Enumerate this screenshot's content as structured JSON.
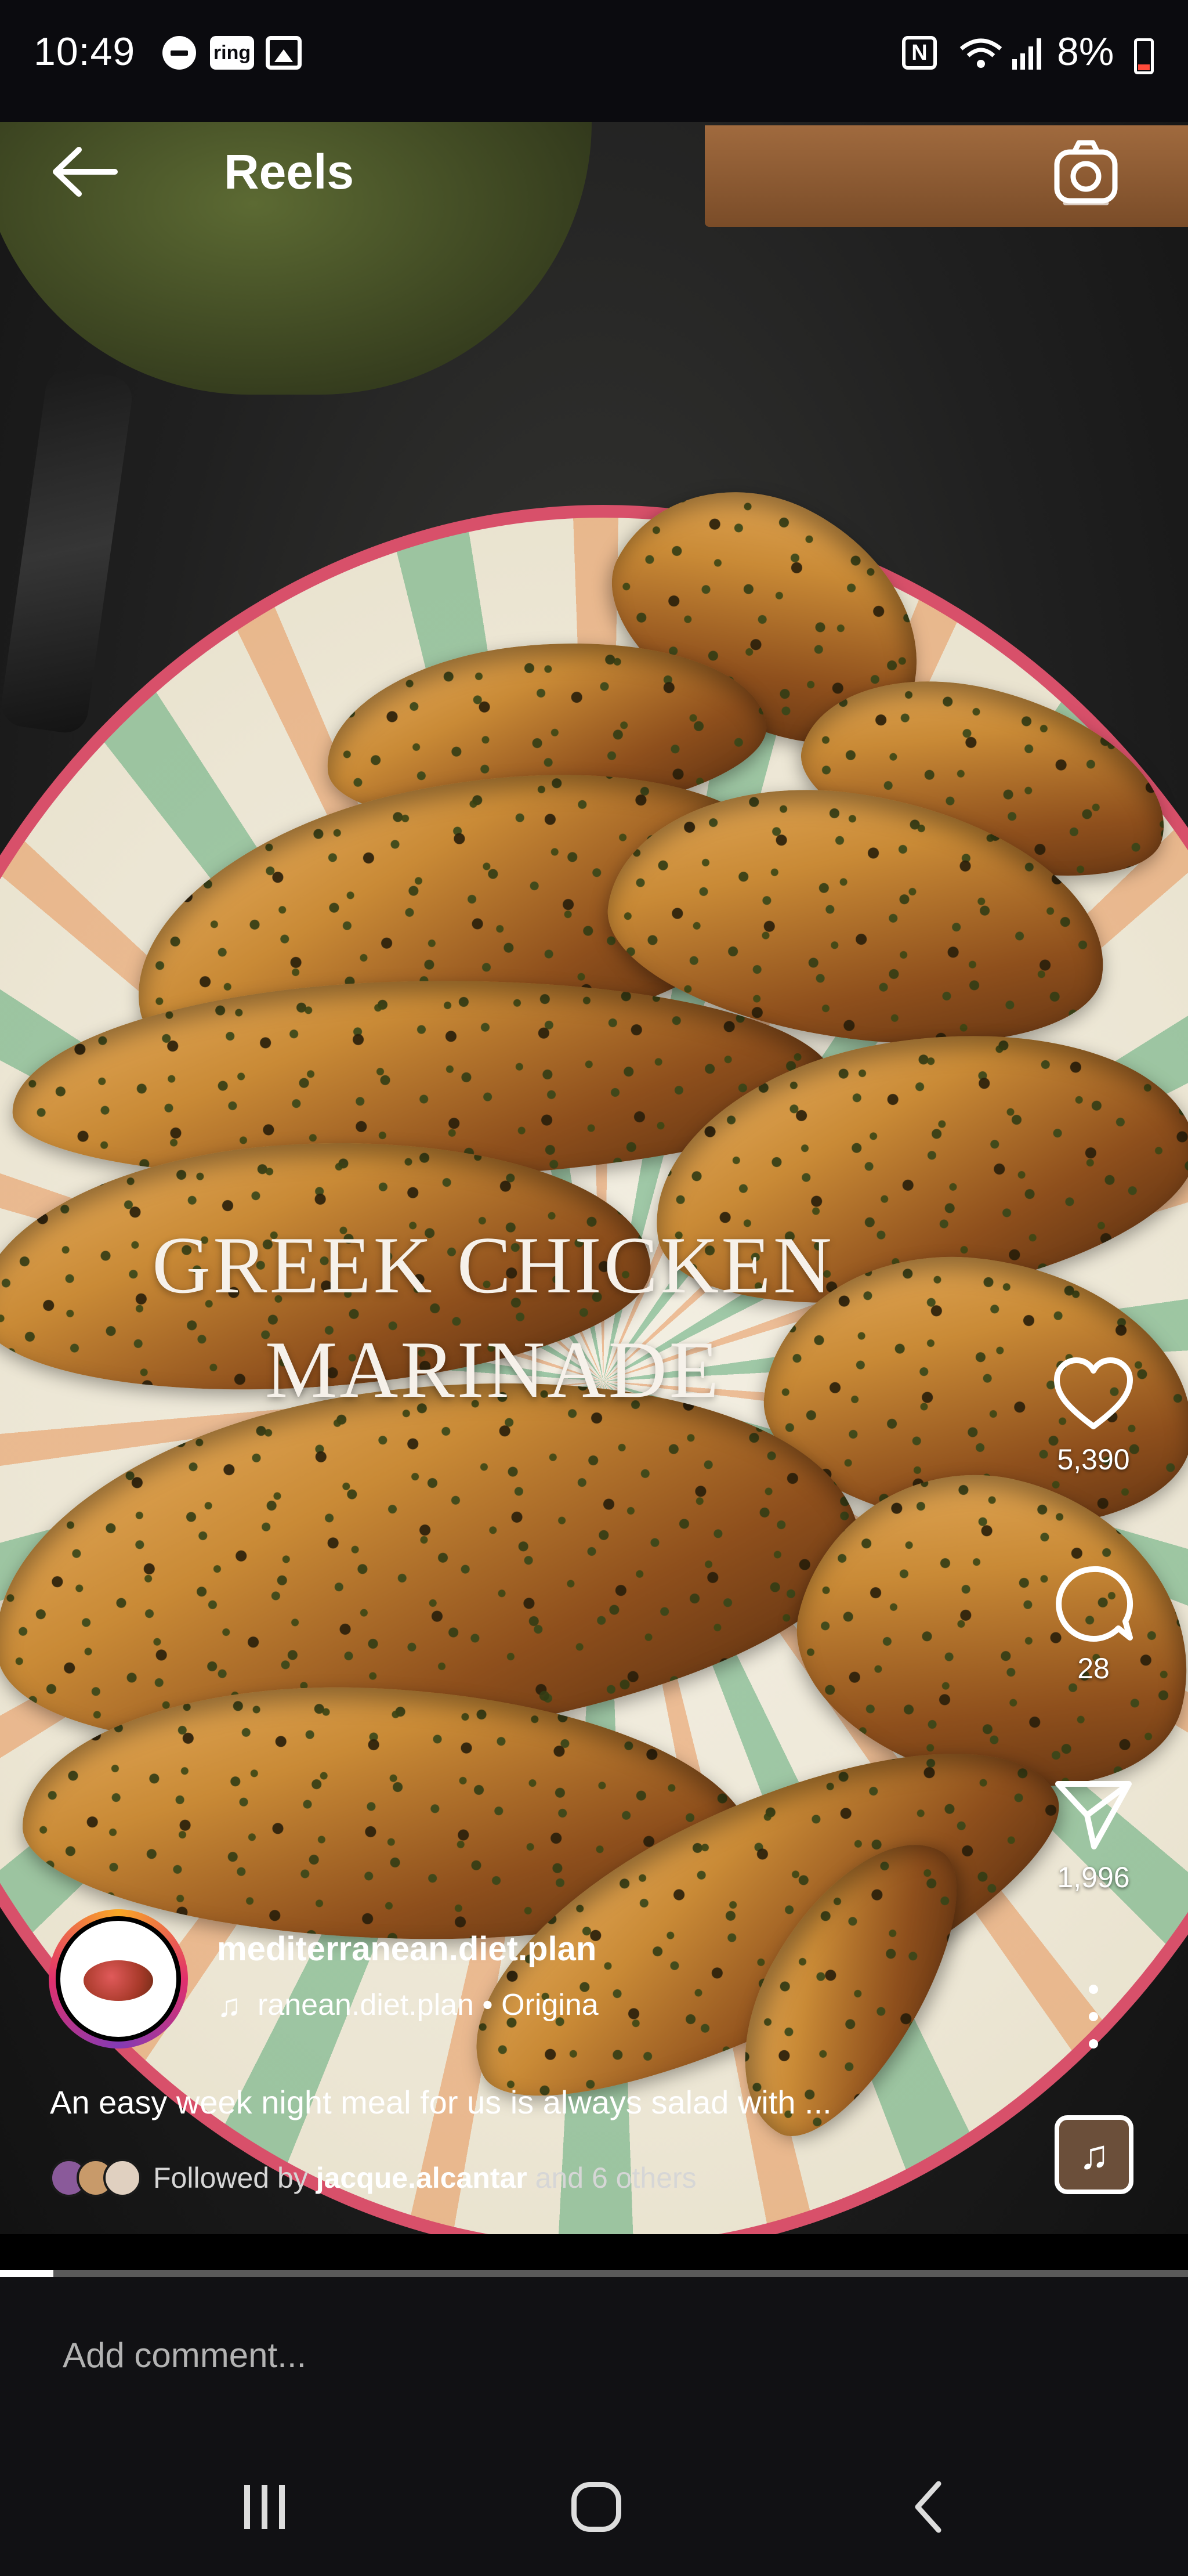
{
  "status_bar": {
    "time": "10:49",
    "ring_label": "ring",
    "battery": "8%"
  },
  "header": {
    "title": "Reels"
  },
  "video": {
    "overlay_title_line1": "GREEK CHICKEN",
    "overlay_title_line2": "MARINADE",
    "progress": 0.045
  },
  "actions": {
    "likes": "5,390",
    "comments": "28",
    "shares": "1,996"
  },
  "post": {
    "username": "mediterranean.diet.plan",
    "audio": "ranean.diet.plan • Origina",
    "caption": "An easy week night meal for us is always salad with ...",
    "followed_prefix": "Followed by",
    "followed_user": "jacque.alcantar",
    "followed_suffix": "and 6 others"
  },
  "comment_bar": {
    "placeholder": "Add comment..."
  },
  "colors": {
    "background": "#000000",
    "plate_rim": "#d8506a",
    "accent_story_ring": "#e1306c"
  },
  "icons": [
    "back-arrow-icon",
    "camera-icon",
    "heart-icon",
    "comment-bubble-icon",
    "send-icon",
    "more-icon",
    "music-note-icon"
  ]
}
